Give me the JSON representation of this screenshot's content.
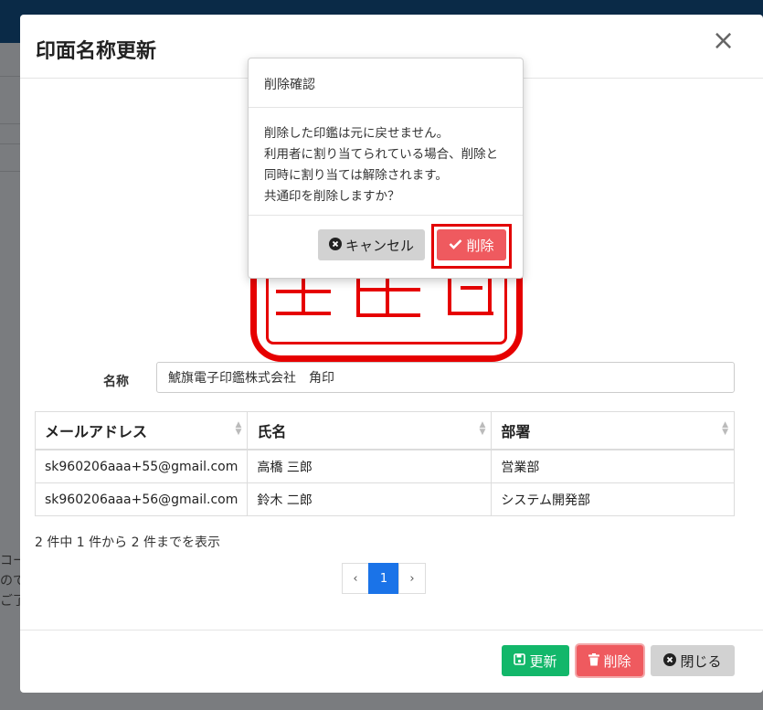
{
  "background": {
    "fragments": [
      "コー",
      "ので",
      "ご了"
    ]
  },
  "modal": {
    "title": "印面名称更新",
    "close_symbol": "×",
    "name_label": "名称",
    "name_value": "鯱旗電子印鑑株式会社　角印",
    "table": {
      "headers": [
        "メールアドレス",
        "氏名",
        "部署"
      ],
      "rows": [
        [
          "sk960206aaa+55@gmail.com",
          "高橋 三郎",
          "営業部"
        ],
        [
          "sk960206aaa+56@gmail.com",
          "鈴木 二郎",
          "システム開発部"
        ]
      ]
    },
    "info": "2 件中 1 件から 2 件までを表示",
    "pagination": {
      "prev": "‹",
      "current": "1",
      "next": "›"
    },
    "buttons": {
      "update": "更新",
      "delete": "削除",
      "close": "閉じる"
    }
  },
  "confirm": {
    "title": "削除確認",
    "lines": [
      "削除した印鑑は元に戻せません。",
      "利用者に割り当てられている場合、削除と",
      "同時に割り当ては解除されます。",
      "共通印を削除しますか？"
    ],
    "cancel_label": "キャンセル",
    "delete_label": "削除"
  },
  "colors": {
    "update_button": "#12b76a",
    "delete_button": "#ef5a5f",
    "seal_red": "#e60000",
    "active_page": "#1a73e8",
    "highlight_frame": "#e20000"
  },
  "icons": {
    "update": "save-icon",
    "delete": "trash-icon",
    "close": "x-circle-icon",
    "cancel": "x-circle-icon",
    "confirm": "check-icon"
  }
}
